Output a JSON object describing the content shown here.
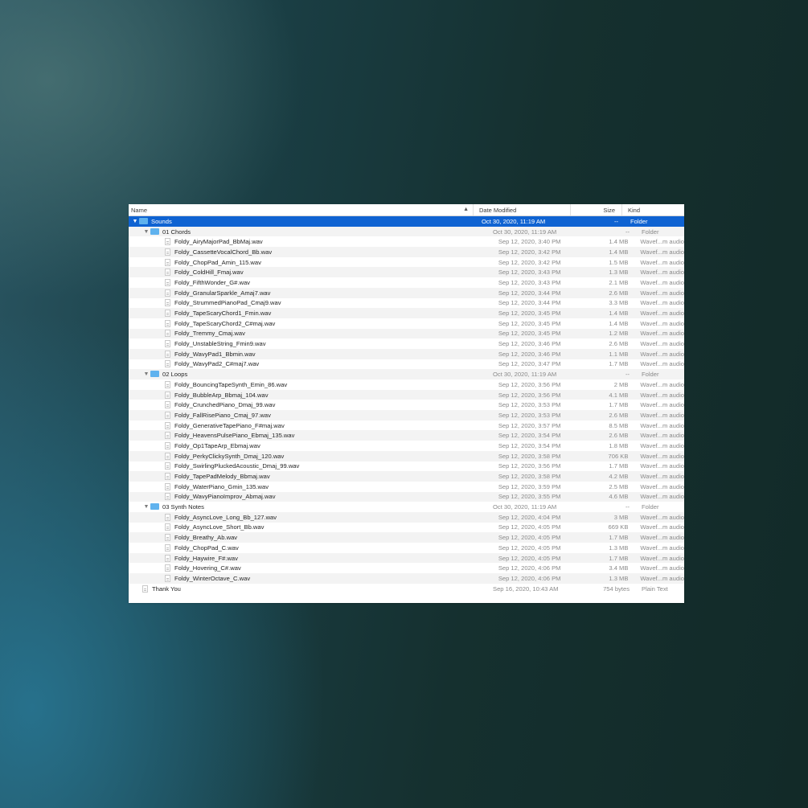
{
  "columns": {
    "name": "Name",
    "date": "Date Modified",
    "size": "Size",
    "kind": "Kind"
  },
  "colors": {
    "selection": "#0f63d2",
    "folder": "#5fb2ee"
  },
  "rows": [
    {
      "name": "Sounds",
      "date": "Oct 30, 2020, 11:19 AM",
      "size": "--",
      "kind": "Folder",
      "type": "folder",
      "level": 0,
      "selected": true,
      "expanded": true
    },
    {
      "name": "01 Chords",
      "date": "Oct 30, 2020, 11:19 AM",
      "size": "--",
      "kind": "Folder",
      "type": "folder",
      "level": 1,
      "expanded": true
    },
    {
      "name": "Foldy_AiryMajorPad_BbMaj.wav",
      "date": "Sep 12, 2020, 3:40 PM",
      "size": "1.4 MB",
      "kind": "Wavef...m audio",
      "type": "file",
      "level": 2
    },
    {
      "name": "Foldy_CassetteVocalChord_Bb.wav",
      "date": "Sep 12, 2020, 3:42 PM",
      "size": "1.4 MB",
      "kind": "Wavef...m audio",
      "type": "file",
      "level": 2
    },
    {
      "name": "Foldy_ChopPad_Amin_115.wav",
      "date": "Sep 12, 2020, 3:42 PM",
      "size": "1.5 MB",
      "kind": "Wavef...m audio",
      "type": "file",
      "level": 2
    },
    {
      "name": "Foldy_ColdHill_Fmaj.wav",
      "date": "Sep 12, 2020, 3:43 PM",
      "size": "1.3 MB",
      "kind": "Wavef...m audio",
      "type": "file",
      "level": 2
    },
    {
      "name": "Foldy_FifthWonder_G#.wav",
      "date": "Sep 12, 2020, 3:43 PM",
      "size": "2.1 MB",
      "kind": "Wavef...m audio",
      "type": "file",
      "level": 2
    },
    {
      "name": "Foldy_GranularSparkle_Amaj7.wav",
      "date": "Sep 12, 2020, 3:44 PM",
      "size": "2.6 MB",
      "kind": "Wavef...m audio",
      "type": "file",
      "level": 2
    },
    {
      "name": "Foldy_StrummedPianoPad_Cmaj9.wav",
      "date": "Sep 12, 2020, 3:44 PM",
      "size": "3.3 MB",
      "kind": "Wavef...m audio",
      "type": "file",
      "level": 2
    },
    {
      "name": "Foldy_TapeScaryChord1_Fmin.wav",
      "date": "Sep 12, 2020, 3:45 PM",
      "size": "1.4 MB",
      "kind": "Wavef...m audio",
      "type": "file",
      "level": 2
    },
    {
      "name": "Foldy_TapeScaryChord2_C#maj.wav",
      "date": "Sep 12, 2020, 3:45 PM",
      "size": "1.4 MB",
      "kind": "Wavef...m audio",
      "type": "file",
      "level": 2
    },
    {
      "name": "Foldy_Tremmy_Cmaj.wav",
      "date": "Sep 12, 2020, 3:45 PM",
      "size": "1.2 MB",
      "kind": "Wavef...m audio",
      "type": "file",
      "level": 2
    },
    {
      "name": "Foldy_UnstableString_Fmin9.wav",
      "date": "Sep 12, 2020, 3:46 PM",
      "size": "2.6 MB",
      "kind": "Wavef...m audio",
      "type": "file",
      "level": 2
    },
    {
      "name": "Foldy_WavyPad1_Bbmin.wav",
      "date": "Sep 12, 2020, 3:46 PM",
      "size": "1.1 MB",
      "kind": "Wavef...m audio",
      "type": "file",
      "level": 2
    },
    {
      "name": "Foldy_WavyPad2_C#maj7.wav",
      "date": "Sep 12, 2020, 3:47 PM",
      "size": "1.7 MB",
      "kind": "Wavef...m audio",
      "type": "file",
      "level": 2
    },
    {
      "name": "02 Loops",
      "date": "Oct 30, 2020, 11:19 AM",
      "size": "--",
      "kind": "Folder",
      "type": "folder",
      "level": 1,
      "expanded": true
    },
    {
      "name": "Foldy_BouncingTapeSynth_Emin_86.wav",
      "date": "Sep 12, 2020, 3:56 PM",
      "size": "2 MB",
      "kind": "Wavef...m audio",
      "type": "file",
      "level": 2
    },
    {
      "name": "Foldy_BubbleArp_Bbmaj_104.wav",
      "date": "Sep 12, 2020, 3:56 PM",
      "size": "4.1 MB",
      "kind": "Wavef...m audio",
      "type": "file",
      "level": 2
    },
    {
      "name": "Foldy_CrunchedPiano_Dmaj_99.wav",
      "date": "Sep 12, 2020, 3:53 PM",
      "size": "1.7 MB",
      "kind": "Wavef...m audio",
      "type": "file",
      "level": 2
    },
    {
      "name": "Foldy_FallRisePiano_Cmaj_97.wav",
      "date": "Sep 12, 2020, 3:53 PM",
      "size": "2.6 MB",
      "kind": "Wavef...m audio",
      "type": "file",
      "level": 2
    },
    {
      "name": "Foldy_GenerativeTapePiano_F#maj.wav",
      "date": "Sep 12, 2020, 3:57 PM",
      "size": "8.5 MB",
      "kind": "Wavef...m audio",
      "type": "file",
      "level": 2
    },
    {
      "name": "Foldy_HeavensPulsePiano_Ebmaj_135.wav",
      "date": "Sep 12, 2020, 3:54 PM",
      "size": "2.6 MB",
      "kind": "Wavef...m audio",
      "type": "file",
      "level": 2
    },
    {
      "name": "Foldy_Op1TapeArp_Ebmaj.wav",
      "date": "Sep 12, 2020, 3:54 PM",
      "size": "1.8 MB",
      "kind": "Wavef...m audio",
      "type": "file",
      "level": 2
    },
    {
      "name": "Foldy_PerkyClickySynth_Dmaj_120.wav",
      "date": "Sep 12, 2020, 3:58 PM",
      "size": "706 KB",
      "kind": "Wavef...m audio",
      "type": "file",
      "level": 2
    },
    {
      "name": "Foldy_SwirlingPluckedAcoustic_Dmaj_99.wav",
      "date": "Sep 12, 2020, 3:56 PM",
      "size": "1.7 MB",
      "kind": "Wavef...m audio",
      "type": "file",
      "level": 2
    },
    {
      "name": "Foldy_TapePadMelody_Bbmaj.wav",
      "date": "Sep 12, 2020, 3:58 PM",
      "size": "4.2 MB",
      "kind": "Wavef...m audio",
      "type": "file",
      "level": 2
    },
    {
      "name": "Foldy_WaterPiano_Gmin_135.wav",
      "date": "Sep 12, 2020, 3:59 PM",
      "size": "2.5 MB",
      "kind": "Wavef...m audio",
      "type": "file",
      "level": 2
    },
    {
      "name": "Foldy_WavyPianoImprov_Abmaj.wav",
      "date": "Sep 12, 2020, 3:55 PM",
      "size": "4.6 MB",
      "kind": "Wavef...m audio",
      "type": "file",
      "level": 2
    },
    {
      "name": "03 Synth Notes",
      "date": "Oct 30, 2020, 11:19 AM",
      "size": "--",
      "kind": "Folder",
      "type": "folder",
      "level": 1,
      "expanded": true
    },
    {
      "name": "Foldy_AsyncLove_Long_Bb_127.wav",
      "date": "Sep 12, 2020, 4:04 PM",
      "size": "3 MB",
      "kind": "Wavef...m audio",
      "type": "file",
      "level": 2
    },
    {
      "name": "Foldy_AsyncLove_Short_Bb.wav",
      "date": "Sep 12, 2020, 4:05 PM",
      "size": "669 KB",
      "kind": "Wavef...m audio",
      "type": "file",
      "level": 2
    },
    {
      "name": "Foldy_Breathy_Ab.wav",
      "date": "Sep 12, 2020, 4:05 PM",
      "size": "1.7 MB",
      "kind": "Wavef...m audio",
      "type": "file",
      "level": 2
    },
    {
      "name": "Foldy_ChopPad_C.wav",
      "date": "Sep 12, 2020, 4:05 PM",
      "size": "1.3 MB",
      "kind": "Wavef...m audio",
      "type": "file",
      "level": 2
    },
    {
      "name": "Foldy_Haywire_F#.wav",
      "date": "Sep 12, 2020, 4:05 PM",
      "size": "1.7 MB",
      "kind": "Wavef...m audio",
      "type": "file",
      "level": 2
    },
    {
      "name": "Foldy_Hovering_C#.wav",
      "date": "Sep 12, 2020, 4:06 PM",
      "size": "3.4 MB",
      "kind": "Wavef...m audio",
      "type": "file",
      "level": 2
    },
    {
      "name": "Foldy_WinterOctave_C.wav",
      "date": "Sep 12, 2020, 4:06 PM",
      "size": "1.3 MB",
      "kind": "Wavef...m audio",
      "type": "file",
      "level": 2
    },
    {
      "name": "Thank You",
      "date": "Sep 16, 2020, 10:43 AM",
      "size": "754 bytes",
      "kind": "Plain Text",
      "type": "file",
      "level": 1
    }
  ]
}
